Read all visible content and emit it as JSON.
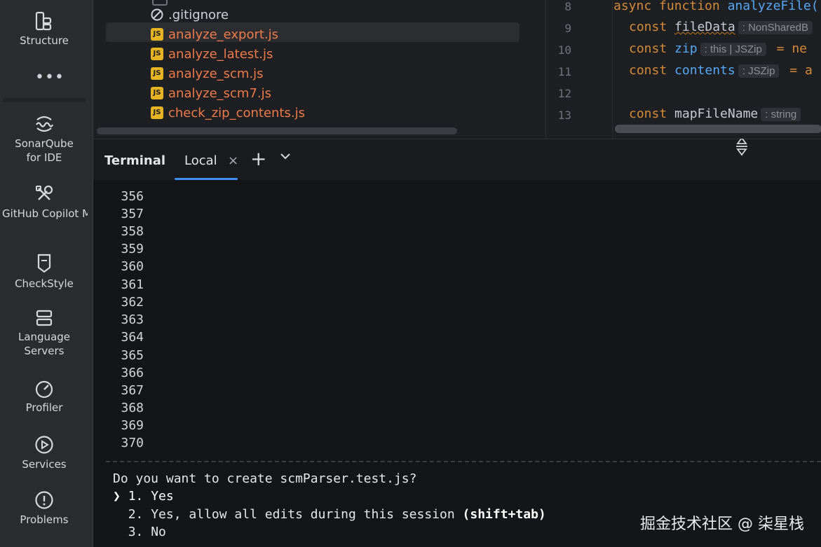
{
  "sidebar": {
    "items": [
      {
        "label": "Structure",
        "icon": "structure-icon"
      },
      {
        "label": "SonarQube\nfor IDE",
        "icon": "sonarqube-icon"
      },
      {
        "label": "GitHub\nCopilot MCP Log",
        "icon": "wrench-icon"
      },
      {
        "label": "CheckStyle",
        "icon": "checkstyle-icon"
      },
      {
        "label": "Language\nServers",
        "icon": "server-icon"
      },
      {
        "label": "Profiler",
        "icon": "gauge-icon"
      },
      {
        "label": "Services",
        "icon": "play-circle-icon"
      },
      {
        "label": "Problems",
        "icon": "alert-circle-icon"
      }
    ],
    "more": "•••"
  },
  "project_tree": {
    "files": [
      {
        "name": ".gitignore",
        "type": "gitignore"
      },
      {
        "name": "analyze_export.js",
        "type": "js",
        "selected": true
      },
      {
        "name": "analyze_latest.js",
        "type": "js"
      },
      {
        "name": "analyze_scm.js",
        "type": "js"
      },
      {
        "name": "analyze_scm7.js",
        "type": "js"
      },
      {
        "name": "check_zip_contents.js",
        "type": "js"
      }
    ],
    "badge": "JS"
  },
  "editor": {
    "line_numbers": [
      "8",
      "9",
      "10",
      "11",
      "12",
      "13"
    ],
    "lines": {
      "l8_kw": "async function",
      "l8_fn": "analyzeFile(",
      "l9_kw": "const",
      "l9_var": "fileData",
      "l9_hint": ": NonSharedB",
      "l10_kw": "const",
      "l10_var": "zip",
      "l10_hint": ": this | JSZip",
      "l10_rest": "= ne",
      "l11_kw": "const",
      "l11_var": "contents",
      "l11_hint": ": JSZip",
      "l11_rest": "= a",
      "l13_kw": "const",
      "l13_var": "mapFileName",
      "l13_hint": ": string"
    }
  },
  "terminal": {
    "title": "Terminal",
    "tabs": [
      {
        "label": "Local",
        "active": true
      }
    ],
    "close": "×",
    "new_tab": "+",
    "line_numbers": [
      "356",
      "357",
      "358",
      "359",
      "360",
      "361",
      "362",
      "363",
      "364",
      "365",
      "366",
      "367",
      "368",
      "369",
      "370"
    ],
    "prompt": {
      "question": "Do you want to create scmParser.test.js?",
      "options": [
        {
          "marker": "❯",
          "number": "1.",
          "text": "Yes",
          "selected": true
        },
        {
          "number": "2.",
          "text": "Yes, allow all edits during this session",
          "hint": "(shift+tab)"
        },
        {
          "number": "3.",
          "text": "No"
        }
      ]
    }
  },
  "watermark": "掘金技术社区 @ 柒星栈",
  "colors": {
    "accent": "#3d8ef5",
    "keyword_terminal": "#e8407a",
    "string": "#e6c072",
    "js_file": "#f07b4a",
    "js_badge": "#e6b422"
  }
}
